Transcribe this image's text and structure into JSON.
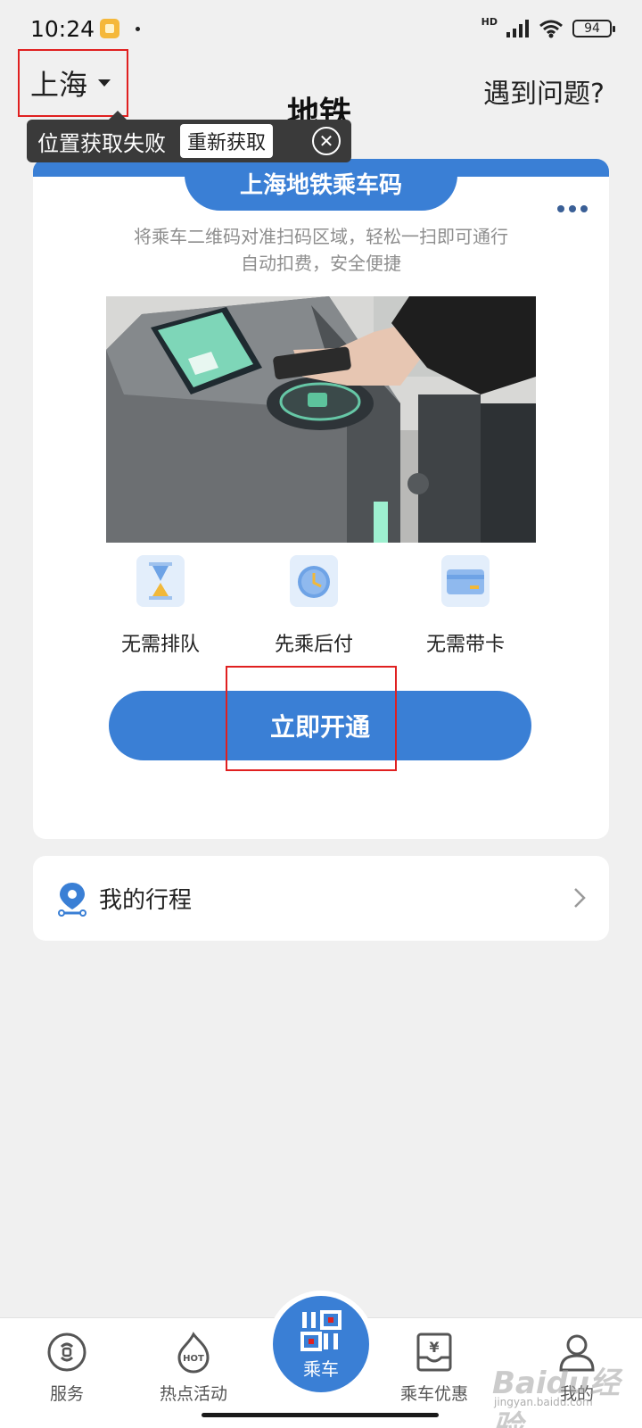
{
  "status_bar": {
    "time": "10:24",
    "network": "HD",
    "battery": "94"
  },
  "header": {
    "city": "上海",
    "title": "地铁",
    "help": "遇到问题?"
  },
  "toast": {
    "message": "位置获取失败",
    "retry_label": "重新获取"
  },
  "main_card": {
    "tab_title": "上海地铁乘车码",
    "description_line1": "将乘车二维码对准扫码区域，轻松一扫即可通行",
    "description_line2": "自动扣费，安全便捷",
    "features": [
      {
        "label": "无需排队",
        "icon": "hourglass-icon"
      },
      {
        "label": "先乘后付",
        "icon": "clock-icon"
      },
      {
        "label": "无需带卡",
        "icon": "card-icon"
      }
    ],
    "open_button": "立即开通"
  },
  "trip": {
    "label": "我的行程"
  },
  "tabbar": {
    "items": [
      {
        "label": "服务",
        "icon": "service-icon"
      },
      {
        "label": "热点活动",
        "icon": "hot-icon"
      },
      {
        "label": "乘车",
        "icon": "qr-code-icon"
      },
      {
        "label": "乘车优惠",
        "icon": "coupon-icon"
      },
      {
        "label": "我的",
        "icon": "profile-icon"
      }
    ]
  },
  "watermark": {
    "text": "Baidu经验",
    "sub": "jingyan.baidu.com"
  },
  "colors": {
    "accent": "#3a7fd5",
    "highlight": "#e02020",
    "background": "#f0f0f0"
  }
}
